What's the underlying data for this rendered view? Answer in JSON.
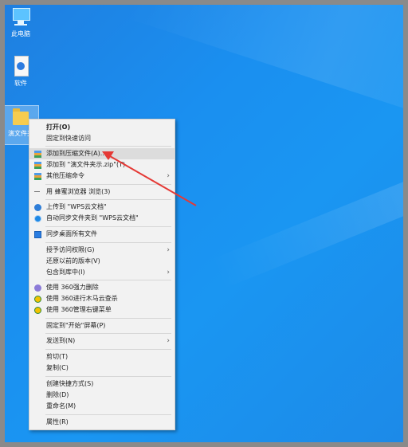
{
  "desktop_icons": [
    {
      "label": "此电脑",
      "icon": "computer-icon"
    },
    {
      "label": "软件",
      "icon": "document-icon"
    },
    {
      "label": "演文件夹",
      "icon": "folder-icon"
    }
  ],
  "context_menu": {
    "items": [
      {
        "label": "打开(O)",
        "bold": true
      },
      {
        "label": "固定到快速访问"
      },
      {
        "label": "添加到压缩文件(A)...",
        "icon": "archive-icon",
        "highlighted": true
      },
      {
        "label": "添加到 \"演文件夹示.zip\"(T)",
        "icon": "archive-icon"
      },
      {
        "label": "其他压缩命令",
        "icon": "archive-icon",
        "submenu": true
      },
      {
        "label": "用 蜂蜜浏览器 浏览(3)",
        "icon": "dash-icon"
      },
      {
        "label": "上传到 \"WPS云文档\"",
        "icon": "cloud-upload-icon"
      },
      {
        "label": "自动同步文件夹到 \"WPS云文档\"",
        "icon": "sync-icon"
      },
      {
        "label": "同步桌面所有文件",
        "icon": "sync-box-icon"
      },
      {
        "label": "授予访问权限(G)",
        "submenu": true
      },
      {
        "label": "还原以前的版本(V)"
      },
      {
        "label": "包含到库中(I)",
        "submenu": true
      },
      {
        "label": "使用 360强力删除",
        "icon": "shred-icon"
      },
      {
        "label": "使用 360进行木马云查杀",
        "icon": "360-shield-icon"
      },
      {
        "label": "使用 360管理右键菜单",
        "icon": "360-shield-icon"
      },
      {
        "label": "固定到\"开始\"屏幕(P)"
      },
      {
        "label": "发送到(N)",
        "submenu": true
      },
      {
        "label": "剪切(T)"
      },
      {
        "label": "复制(C)"
      },
      {
        "label": "创建快捷方式(S)"
      },
      {
        "label": "删除(D)"
      },
      {
        "label": "重命名(M)"
      },
      {
        "label": "属性(R)"
      }
    ]
  },
  "colors": {
    "desktop": "#1a8ff0",
    "menu_bg": "#f2f2f2",
    "highlight": "#dcdcdc",
    "annotation_arrow": "#e53935"
  }
}
